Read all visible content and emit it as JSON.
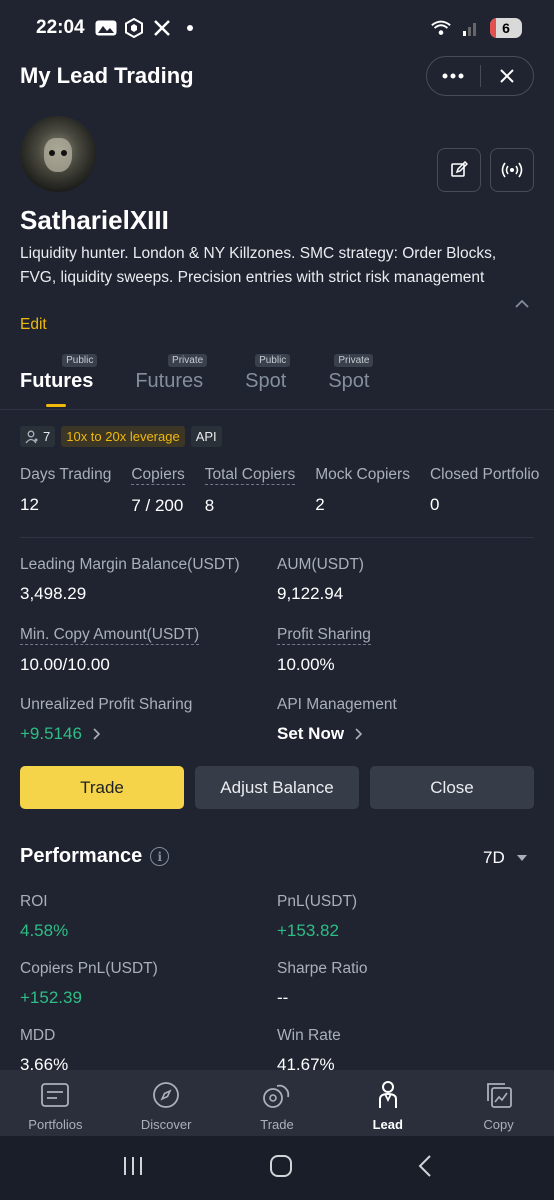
{
  "status_bar": {
    "time": "22:04",
    "battery_level": "6",
    "icons": [
      "photos-icon",
      "crypto-icon",
      "x-icon",
      "dot-icon",
      "wifi-6e-icon",
      "signal-icon",
      "battery-icon"
    ]
  },
  "header": {
    "title": "My Lead Trading",
    "more_icon": "more-dots-icon",
    "close_icon": "close-icon"
  },
  "profile": {
    "username": "SatharielXIII",
    "bio": "Liquidity hunter. London & NY Killzones. SMC strategy: Order Blocks, FVG, liquidity sweeps. Precision entries with strict risk management",
    "edit_label": "Edit"
  },
  "tabs": [
    {
      "label": "Futures",
      "badge": "Public",
      "active": true
    },
    {
      "label": "Futures",
      "badge": "Private",
      "active": false
    },
    {
      "label": "Spot",
      "badge": "Public",
      "active": false
    },
    {
      "label": "Spot",
      "badge": "Private",
      "active": false
    }
  ],
  "tags": {
    "copiers_count": "7",
    "leverage": "10x to 20x leverage",
    "api": "API"
  },
  "stats": [
    {
      "label": "Days Trading",
      "value": "12"
    },
    {
      "label": "Copiers",
      "value": "7 / 200"
    },
    {
      "label": "Total Copiers",
      "value": "8"
    },
    {
      "label": "Mock Copiers",
      "value": "2"
    },
    {
      "label": "Closed Portfolio",
      "value": "0"
    }
  ],
  "details": {
    "leading_margin_label": "Leading Margin Balance(USDT)",
    "leading_margin_value": "3,498.29",
    "aum_label": "AUM(USDT)",
    "aum_value": "9,122.94",
    "min_copy_label": "Min. Copy Amount(USDT)",
    "min_copy_value": "10.00/10.00",
    "profit_sharing_label": "Profit Sharing",
    "profit_sharing_value": "10.00%",
    "unrealized_label": "Unrealized Profit Sharing",
    "unrealized_value": "+9.5146",
    "api_mgmt_label": "API Management",
    "api_mgmt_value": "Set Now"
  },
  "actions": {
    "trade": "Trade",
    "adjust_balance": "Adjust Balance",
    "close": "Close"
  },
  "performance": {
    "title": "Performance",
    "period": "7D",
    "roi_label": "ROI",
    "roi_value": "4.58%",
    "pnl_label": "PnL(USDT)",
    "pnl_value": "+153.82",
    "copiers_pnl_label": "Copiers PnL(USDT)",
    "copiers_pnl_value": "+152.39",
    "sharpe_label": "Sharpe Ratio",
    "sharpe_value": "--",
    "mdd_label": "MDD",
    "mdd_value": "3.66%",
    "winrate_label": "Win Rate",
    "winrate_value": "41.67%"
  },
  "bottom_nav": [
    {
      "label": "Portfolios",
      "icon": "portfolios-icon"
    },
    {
      "label": "Discover",
      "icon": "compass-icon"
    },
    {
      "label": "Trade",
      "icon": "trade-icon"
    },
    {
      "label": "Lead",
      "icon": "lead-icon",
      "active": true
    },
    {
      "label": "Copy",
      "icon": "copy-icon"
    }
  ],
  "colors": {
    "background": "#1f2430",
    "accent_yellow": "#f0b90b",
    "button_yellow": "#f5d44a",
    "positive_green": "#2ebd85"
  }
}
